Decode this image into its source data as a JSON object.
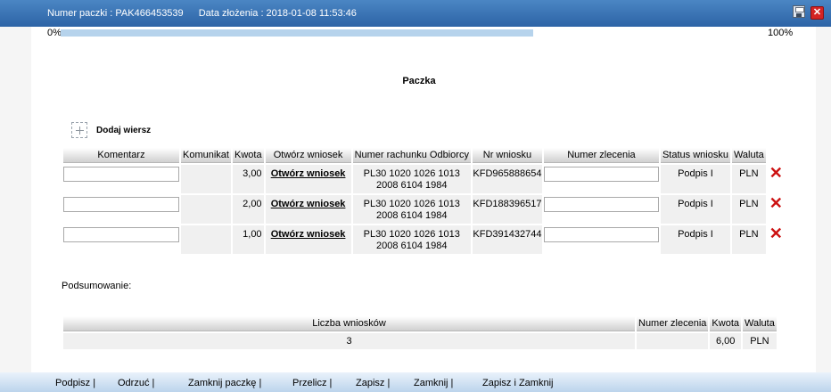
{
  "header": {
    "package_label": "Numer paczki : PAK466453539",
    "date_label": "Data złożenia : 2018-01-08 11:53:46",
    "icons": [
      "save-icon",
      "close-icon"
    ]
  },
  "progress": {
    "start_label": "0%",
    "end_label": "100%",
    "value": 100
  },
  "title": "Paczka",
  "add_row_label": "Dodaj wiersz",
  "table": {
    "headers": [
      "Komentarz",
      "Komunikat",
      "Kwota",
      "Otwórz wniosek",
      "Numer rachunku Odbiorcy",
      "Nr wniosku",
      "Numer zlecenia",
      "Status wniosku",
      "Waluta"
    ],
    "rows": [
      {
        "komentarz": "",
        "komunikat": "",
        "kwota": "3,00",
        "link": "Otwórz wniosek",
        "account_line1": "PL30 1020 1026 1013",
        "account_line2": "2008 6104 1984",
        "nr_wniosku": "KFD965888654",
        "numer_zlecenia": "",
        "status": "Podpis I",
        "waluta": "PLN"
      },
      {
        "komentarz": "",
        "komunikat": "",
        "kwota": "2,00",
        "link": "Otwórz wniosek",
        "account_line1": "PL30 1020 1026 1013",
        "account_line2": "2008 6104 1984",
        "nr_wniosku": "KFD188396517",
        "numer_zlecenia": "",
        "status": "Podpis I",
        "waluta": "PLN"
      },
      {
        "komentarz": "",
        "komunikat": "",
        "kwota": "1,00",
        "link": "Otwórz wniosek",
        "account_line1": "PL30 1020 1026 1013",
        "account_line2": "2008 6104 1984",
        "nr_wniosku": "KFD391432744",
        "numer_zlecenia": "",
        "status": "Podpis I",
        "waluta": "PLN"
      }
    ]
  },
  "summary": {
    "label": "Podsumowanie:",
    "headers": [
      "Liczba wniosków",
      "Numer zlecenia",
      "Kwota",
      "Waluta"
    ],
    "row": {
      "liczba": "3",
      "numer_zlecenia": "",
      "kwota": "6,00",
      "waluta": "PLN"
    }
  },
  "footer": {
    "actions": [
      "Podpisz |",
      "Odrzuć |",
      "Zamknij paczkę |",
      "Przelicz |",
      "Zapisz |",
      "Zamknij |",
      "Zapisz i Zamknij"
    ]
  },
  "colors": {
    "titlebar": "#2d63a6",
    "delete": "#cc1111",
    "footer": "#bcd4ec"
  }
}
